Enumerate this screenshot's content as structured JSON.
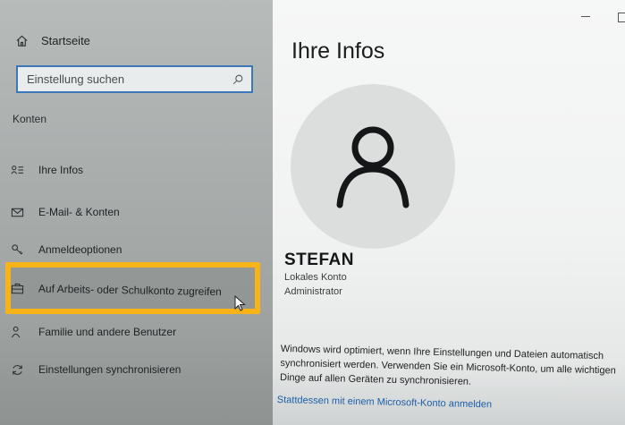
{
  "sidebar": {
    "home_label": "Startseite",
    "search_placeholder": "Einstellung suchen",
    "section_title": "Konten",
    "items": [
      {
        "label": "Ihre Infos",
        "icon": "person-list-icon"
      },
      {
        "label": "E-Mail- & Konten",
        "icon": "mail-icon"
      },
      {
        "label": "Anmeldeoptionen",
        "icon": "key-icon"
      },
      {
        "label": "Auf Arbeits- oder Schulkonto zugreifen",
        "icon": "briefcase-icon"
      },
      {
        "label": "Familie und andere Benutzer",
        "icon": "family-icon"
      },
      {
        "label": "Einstellungen synchronisieren",
        "icon": "sync-icon"
      }
    ],
    "highlight_color": "#f7b318"
  },
  "main": {
    "title": "Ihre Infos",
    "username": "STEFAN",
    "account_type": "Lokales Konto",
    "account_role": "Administrator",
    "info_text": "Windows wird optimiert, wenn Ihre Einstellungen und Dateien automatisch synchronisiert werden. Verwenden Sie ein Microsoft-Konto, um alle wichtigen Dinge auf allen Geräten zu synchronisieren.",
    "link_text": "Stattdessen mit einem Microsoft-Konto anmelden",
    "link_color": "#1c5fa8"
  }
}
